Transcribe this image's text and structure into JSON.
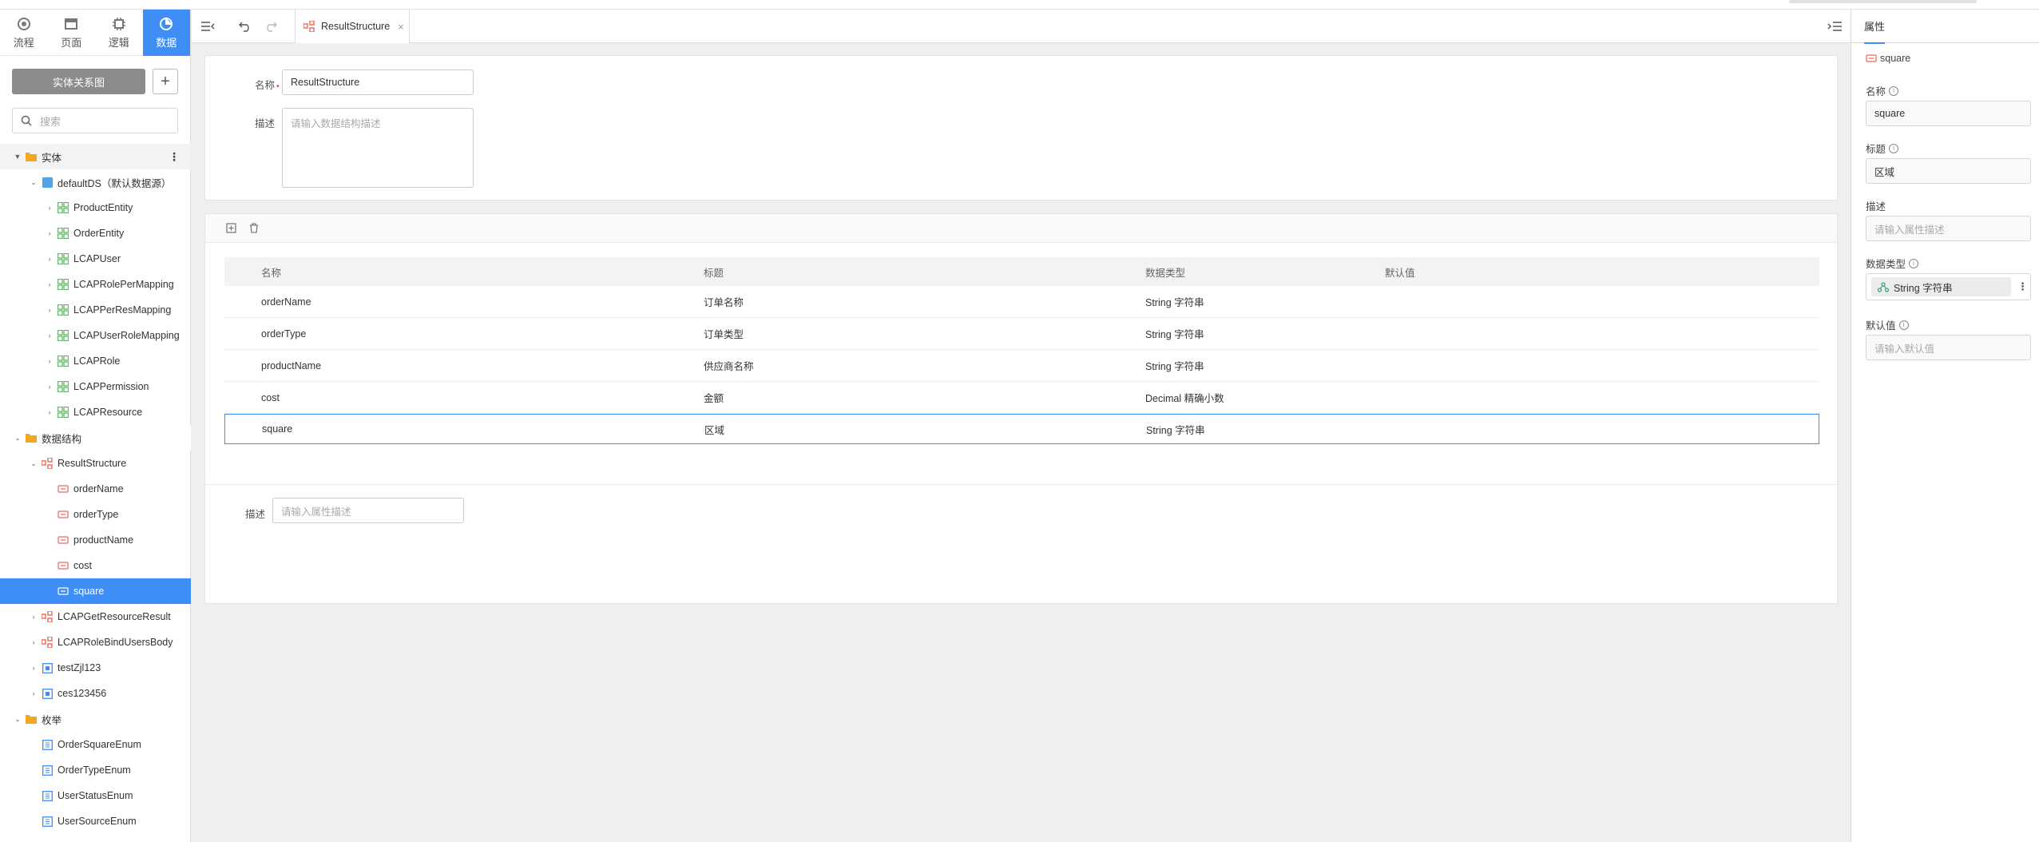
{
  "sidebar": {
    "tabs": [
      {
        "label": "流程",
        "icon": "flow-icon"
      },
      {
        "label": "页面",
        "icon": "page-icon"
      },
      {
        "label": "逻辑",
        "icon": "logic-icon"
      },
      {
        "label": "数据",
        "icon": "data-icon"
      }
    ],
    "er_button": "实体关系图",
    "add_button": "+",
    "search_placeholder": "搜索",
    "tree": {
      "entities_group": "实体",
      "datasource": "defaultDS（默认数据源）",
      "entities": [
        "ProductEntity",
        "OrderEntity",
        "LCAPUser",
        "LCAPRolePerMapping",
        "LCAPPerResMapping",
        "LCAPUserRoleMapping",
        "LCAPRole",
        "LCAPPermission",
        "LCAPResource"
      ],
      "structures_group": "数据结构",
      "result_structure": "ResultStructure",
      "fields": [
        "orderName",
        "orderType",
        "productName",
        "cost",
        "square"
      ],
      "other_structures": [
        "LCAPGetResourceResult",
        "LCAPRoleBindUsersBody"
      ],
      "others": [
        "testZjl123",
        "ces123456"
      ],
      "enums_group": "枚举",
      "enums": [
        "OrderSquareEnum",
        "OrderTypeEnum",
        "UserStatusEnum",
        "UserSourceEnum"
      ]
    }
  },
  "toolbar": {
    "tab_label": "ResultStructure",
    "tab_close": "×"
  },
  "form": {
    "name_label": "名称",
    "required_mark": "•",
    "name_value": "ResultStructure",
    "desc_label": "描述",
    "desc_placeholder": "请输入数据结构描述"
  },
  "table": {
    "headers": [
      "名称",
      "标题",
      "数据类型",
      "默认值"
    ],
    "rows": [
      {
        "name": "orderName",
        "title": "订单名称",
        "type": "String 字符串"
      },
      {
        "name": "orderType",
        "title": "订单类型",
        "type": "String 字符串"
      },
      {
        "name": "productName",
        "title": "供应商名称",
        "type": "String 字符串"
      },
      {
        "name": "cost",
        "title": "金额",
        "type": "Decimal 精确小数"
      },
      {
        "name": "square",
        "title": "区域",
        "type": "String 字符串"
      }
    ],
    "desc_label": "描述",
    "desc_placeholder": "请输入属性描述"
  },
  "props": {
    "tab": "属性",
    "item_name": "square",
    "name_label": "名称",
    "name_value": "square",
    "title_label": "标题",
    "title_value": "区域",
    "desc_label": "描述",
    "desc_placeholder": "请输入属性描述",
    "type_label": "数据类型",
    "type_value": "String 字符串",
    "default_label": "默认值",
    "default_placeholder": "请输入默认值"
  },
  "colors": {
    "accent": "#3f8ef7",
    "entity": "#5fb85a",
    "structure": "#e8685a",
    "enum": "#3f8ef7",
    "folder": "#f5a623"
  }
}
